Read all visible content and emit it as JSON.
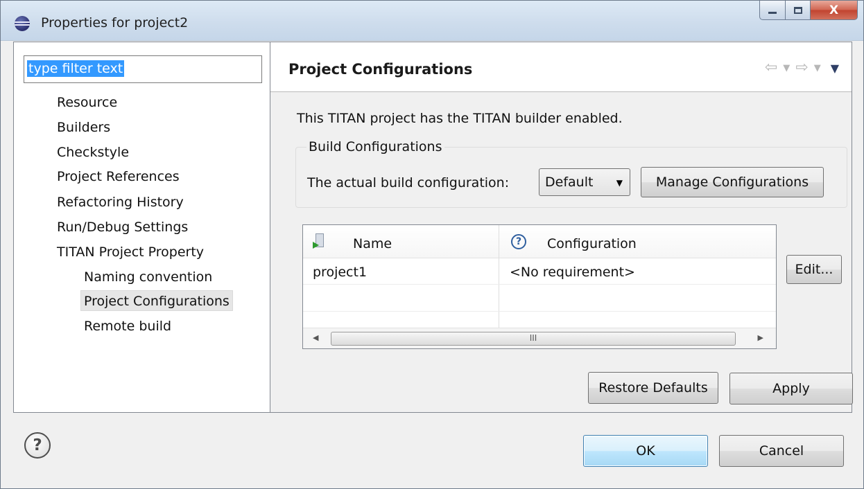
{
  "window": {
    "title": "Properties for project2",
    "close_glyph": "X"
  },
  "sidebar": {
    "filter_text": "type filter text",
    "items": [
      {
        "label": "Resource"
      },
      {
        "label": "Builders"
      },
      {
        "label": "Checkstyle"
      },
      {
        "label": "Project References"
      },
      {
        "label": "Refactoring History"
      },
      {
        "label": "Run/Debug Settings"
      },
      {
        "label": "TITAN Project Property"
      },
      {
        "label": "Naming convention"
      },
      {
        "label": "Project Configurations",
        "selected": true
      },
      {
        "label": "Remote build"
      }
    ]
  },
  "page": {
    "title": "Project Configurations",
    "description": "This TITAN project has the TITAN builder enabled.",
    "group_title": "Build Configurations",
    "build_label": "The actual build configuration:",
    "build_config_value": "Default",
    "manage_button": "Manage Configurations",
    "table": {
      "columns": [
        "Name",
        "Configuration"
      ],
      "rows": [
        {
          "name": "project1",
          "configuration": "<No requirement>"
        }
      ],
      "scroll_grip": "III"
    },
    "edit_button": "Edit...",
    "restore_button": "Restore Defaults",
    "apply_button": "Apply"
  },
  "footer": {
    "ok_button": "OK",
    "cancel_button": "Cancel"
  },
  "icons": {
    "window_icon": "eclipse-icon",
    "help": "help-icon",
    "question_mark": "?"
  }
}
